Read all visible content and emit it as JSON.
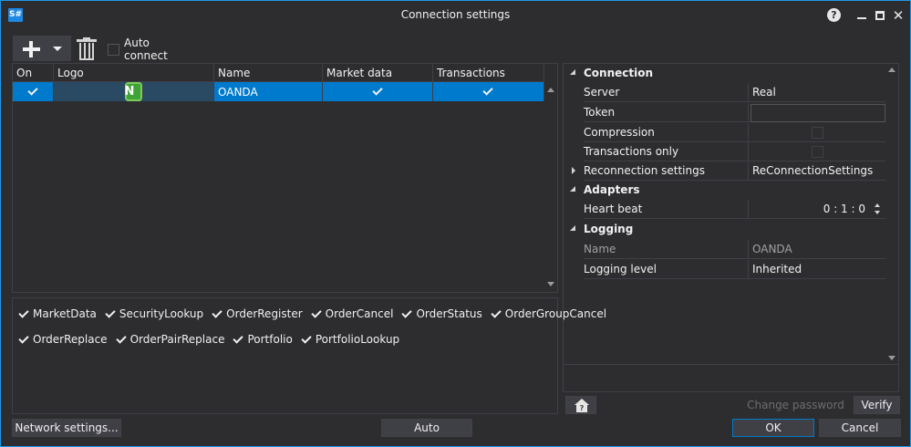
{
  "window": {
    "app_icon": "S#",
    "title": "Connection settings",
    "help_icon": "?"
  },
  "toolbar": {
    "add_icon": "plus-icon",
    "delete_icon": "trash-icon",
    "auto_connect_label": "Auto connect",
    "auto_connect_checked": false
  },
  "grid": {
    "columns": [
      "On",
      "Logo",
      "Name",
      "Market data",
      "Transactions"
    ],
    "rows": [
      {
        "on": true,
        "logo": "N",
        "name": "OANDA",
        "market_data": true,
        "transactions": true
      }
    ]
  },
  "message_types": {
    "line1": [
      "MarketData",
      "SecurityLookup",
      "OrderRegister",
      "OrderCancel",
      "OrderStatus",
      "OrderGroupCancel"
    ],
    "line2": [
      "OrderReplace",
      "OrderPairReplace",
      "Portfolio",
      "PortfolioLookup"
    ]
  },
  "properties": {
    "connection": {
      "label": "Connection",
      "server_name": "Server",
      "server_value": "Real",
      "token_name": "Token",
      "token_value": "",
      "compression_name": "Compression",
      "transactions_only_name": "Transactions only",
      "reconnection_name": "Reconnection settings",
      "reconnection_value": "ReConnectionSettings"
    },
    "adapters": {
      "label": "Adapters",
      "heartbeat_name": "Heart beat",
      "heartbeat_value": "0 : 1 : 0"
    },
    "logging": {
      "label": "Logging",
      "name_name": "Name",
      "name_value": "OANDA",
      "level_name": "Logging level",
      "level_value": "Inherited"
    }
  },
  "buttons": {
    "network_settings": "Network settings...",
    "auto": "Auto",
    "change_password": "Change password",
    "verify": "Verify",
    "ok": "OK",
    "cancel": "Cancel"
  },
  "colors": {
    "accent": "#007acc",
    "background": "#2d2d30",
    "border": "#3f3f46",
    "selection": "#007acc"
  }
}
